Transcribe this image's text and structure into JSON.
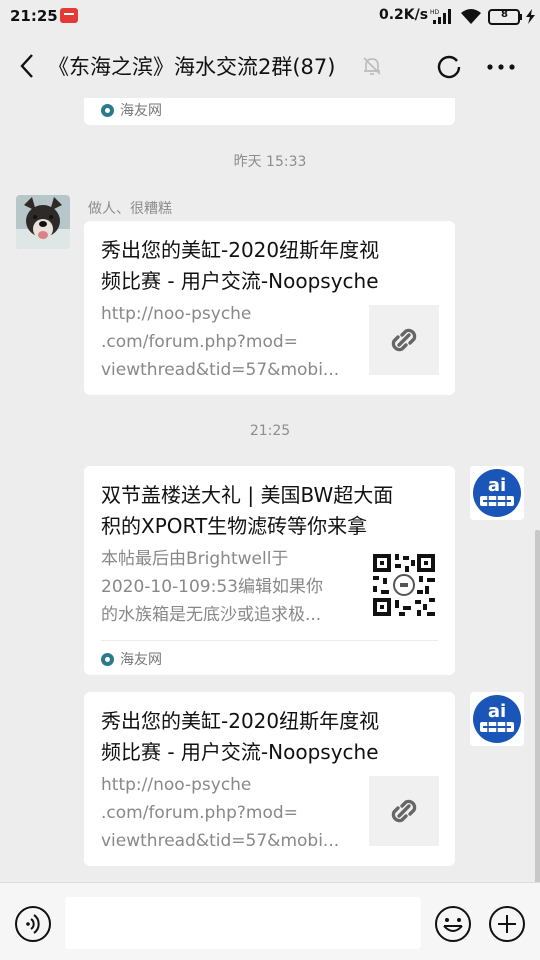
{
  "status_bar": {
    "time": "21:25",
    "network_speed": "0.2K/s",
    "battery": "8"
  },
  "header": {
    "title": "《东海之滨》海水交流2群(87)"
  },
  "messages": {
    "top_card": {
      "source": "海友网"
    },
    "timestamp_1": "昨天 15:33",
    "msg_1": {
      "sender": "做人、很糟糕",
      "title_line1": "秀出您的美缸-2020纽斯年度视",
      "title_line2": "频比赛 - 用户交流-Noopsyche",
      "desc_line1": "http://noo-psyche",
      "desc_line2": ".com/forum.php?mod=",
      "desc_line3": "viewthread&tid=57&mobi..."
    },
    "timestamp_2": "21:25",
    "msg_2": {
      "title_line1": "双节盖楼送大礼 | 美国BW超大面",
      "title_line2": "积的XPORT生物滤砖等你来拿",
      "desc_line1": "本帖最后由Brightwell于",
      "desc_line2": "2020-10-109:53编辑如果你",
      "desc_line3": "的水族箱是无底沙或追求极...",
      "source": "海友网"
    },
    "msg_3": {
      "title_line1": "秀出您的美缸-2020纽斯年度视",
      "title_line2": "频比赛 - 用户交流-Noopsyche",
      "desc_line1": "http://noo-psyche",
      "desc_line2": ".com/forum.php?mod=",
      "desc_line3": "viewthread&tid=57&mobi..."
    }
  },
  "input_bar": {
    "placeholder": ""
  },
  "colors": {
    "background": "#ededed",
    "card": "#ffffff",
    "muted_text": "#8d8d8d",
    "avatar_blue": "#1a56b8"
  },
  "icons": [
    "back-arrow-icon",
    "mute-bell-icon",
    "refresh-icon",
    "more-icon",
    "link-icon",
    "qr-code-icon",
    "voice-icon",
    "emoji-icon",
    "plus-icon"
  ]
}
